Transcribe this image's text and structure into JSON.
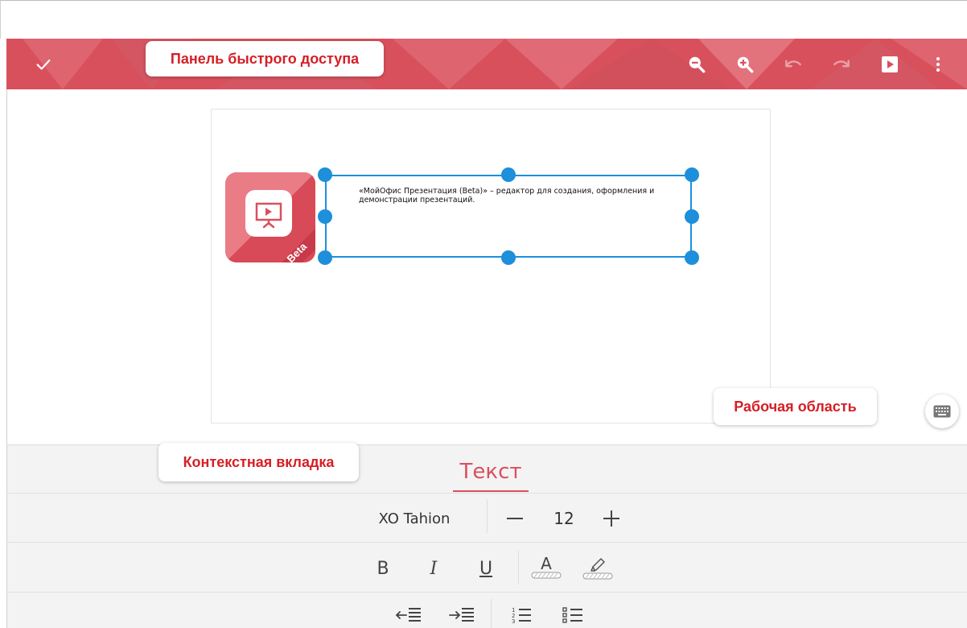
{
  "toolbar": {
    "buttons": [
      {
        "name": "done",
        "icon": "check-icon",
        "enabled": true
      },
      {
        "name": "zoom-out",
        "icon": "zoom-out-icon",
        "enabled": true
      },
      {
        "name": "zoom-in",
        "icon": "zoom-in-icon",
        "enabled": true
      },
      {
        "name": "undo",
        "icon": "undo-icon",
        "enabled": false
      },
      {
        "name": "redo",
        "icon": "redo-icon",
        "enabled": false
      },
      {
        "name": "play",
        "icon": "play-icon",
        "enabled": true
      },
      {
        "name": "more",
        "icon": "more-vert-icon",
        "enabled": true
      }
    ],
    "color": "#d9505d"
  },
  "callouts": {
    "quick_access": "Панель быстрого доступа",
    "work_area": "Рабочая область",
    "context_tab": "Контекстная вкладка"
  },
  "slide": {
    "logo_label": "Beta",
    "text": "«МойОфис Презентация (Beta)» – редактор для создания, оформления и демонстрации презентаций."
  },
  "panel": {
    "active_tab": "Текст",
    "font_name": "XO Tahion",
    "font_size": "12",
    "format": {
      "bold": "B",
      "italic": "I",
      "underline": "U",
      "font_color": "A"
    }
  },
  "colors": {
    "accent": "#d9505d",
    "callout_text": "#d51f26",
    "selection": "#1d8fdb"
  }
}
